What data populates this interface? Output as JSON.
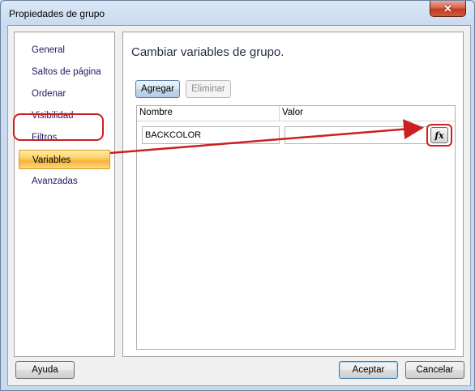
{
  "window": {
    "title": "Propiedades de grupo",
    "close_glyph": "✕"
  },
  "nav": {
    "items": [
      {
        "label": "General"
      },
      {
        "label": "Saltos de página"
      },
      {
        "label": "Ordenar"
      },
      {
        "label": "Visibilidad"
      },
      {
        "label": "Filtros"
      },
      {
        "label": "Variables",
        "selected": true
      },
      {
        "label": "Avanzadas"
      }
    ]
  },
  "content": {
    "heading": "Cambiar variables de grupo.",
    "add_label": "Agregar",
    "remove_label": "Eliminar",
    "grid": {
      "columns": [
        "Nombre",
        "Valor"
      ],
      "rows": [
        {
          "name": "BACKCOLOR",
          "value": ""
        }
      ]
    },
    "fx_label": "fx"
  },
  "footer": {
    "help_label": "Ayuda",
    "ok_label": "Aceptar",
    "cancel_label": "Cancelar"
  },
  "colors": {
    "annotation": "#cc1f1f",
    "selected_item": "#f7b33d"
  }
}
